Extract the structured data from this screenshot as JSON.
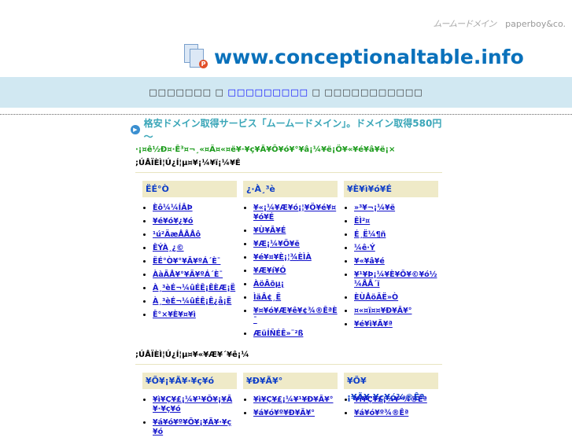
{
  "header": {
    "brand_muumuu": "ムームードメイン",
    "brand_paperboy": "paperboy&co.",
    "domain": "www.conceptionaltable.info",
    "nav_left": "□□□□□□□ □",
    "nav_link": "□□□□□□□□□",
    "nav_right": "□ □□□□□□□□□□□"
  },
  "banner": "格安ドメイン取得サービス「ムームードメイン」。ドメイン取得580円～",
  "green_text": "·¡¤ê½Ð¤·Ê³¤¬¸«¤Ä¤«¤ë¥·¥ç¥Ã¥Ô¥ó¥°¥â¡¼¥ë¡Ö¥«¥é¥â¥ë¡×",
  "sections": [
    {
      "heading": ";ÚÅÏÈÌ¦Ú¿Í¦µ¤¥¡¼¥ï¡¼¥É",
      "columns": [
        {
          "title": "ËÉ°Ò",
          "items": [
            "Èô¼¼ÍÂÞ",
            "¥é¥ó¥¿¥ó",
            "¹ú²ÄæÅÅÅô",
            "ÊÝÀ¸¿©",
            "ËÉ°Ò¥°¥Ã¥ºÁ´È¯",
            "ÀàÃÅ¥°¥Ã¥ºÁ´È¯",
            "À¸³èÉ¬¼ûÉÊ¡ÊÈÆ¡Ë",
            "À¸³èÉ¬¼ûÉÊ¡Ê¿å¡Ë",
            "Ê°×¥È¥¤¥ì"
          ]
        },
        {
          "title": "¿·À¸³è",
          "items": [
            "¥«¡¼¥Æ¥ó¡¦¥Ö¥é¥¤¥ó¥É",
            "¥Ù¥Ã¥É",
            "¥Æ¡¼¥Ö¥ë",
            "¥é¥¤¥È¡¦¾ÈÌÀ",
            "¥Æ¥í¥Ó",
            "ÀöÂõµ¡",
            "ÌäÂ¢¸Ë",
            "¥¤¥ó¥Æ¥ê¥¢¾®ÊªÈ¯",
            "ÆüÍÑÉÊ»¨²ß"
          ]
        },
        {
          "title": "¥È¥ì¥ó¥É",
          "items": [
            "»³¥¬¡¼¥ë",
            "ÊÌ²¤",
            "É¸Ë¼¶ñ",
            "¼ê·Ý",
            "¥«¥â¥é",
            "¥¹¥Þ¡¼¥È¥Õ¥©¥ó½¼ÅÅ´ï",
            "ÈÙÅöÃË»Ò",
            "¤«¤ï¤¤¥Ð¥Ã¥°",
            "¥é¥ì¥Ã¥ª"
          ]
        }
      ]
    },
    {
      "heading": ";ÚÅÏÈÌ¦Ú¿Í¦µ¤¥«¥Æ¥´¥ê¡¼",
      "columns": [
        {
          "title": "¥Õ¥¡¥Ã¥·¥ç¥ó",
          "items": [
            "¥ì¥Ç¥£¡¼¥¹¥Õ¥¡¥Ã¥·¥ç¥ó",
            "¥á¥ó¥º¥Õ¥¡¥Ã¥·¥ç¥ó"
          ]
        },
        {
          "title": "¥Ð¥Ã¥°",
          "items": [
            "¥ì¥Ç¥£¡¼¥¹¥Ð¥Ã¥°",
            "¥á¥ó¥º¥Ð¥Ã¥°"
          ]
        },
        {
          "title": "¥Õ¥¡¥Ã¥·¥ç¥ó¾®Êª",
          "items": [
            "¥ì¥Ç¥£¡¼¥¹¾®Êª",
            "¥á¥ó¥º¾®Êª"
          ]
        }
      ]
    }
  ]
}
